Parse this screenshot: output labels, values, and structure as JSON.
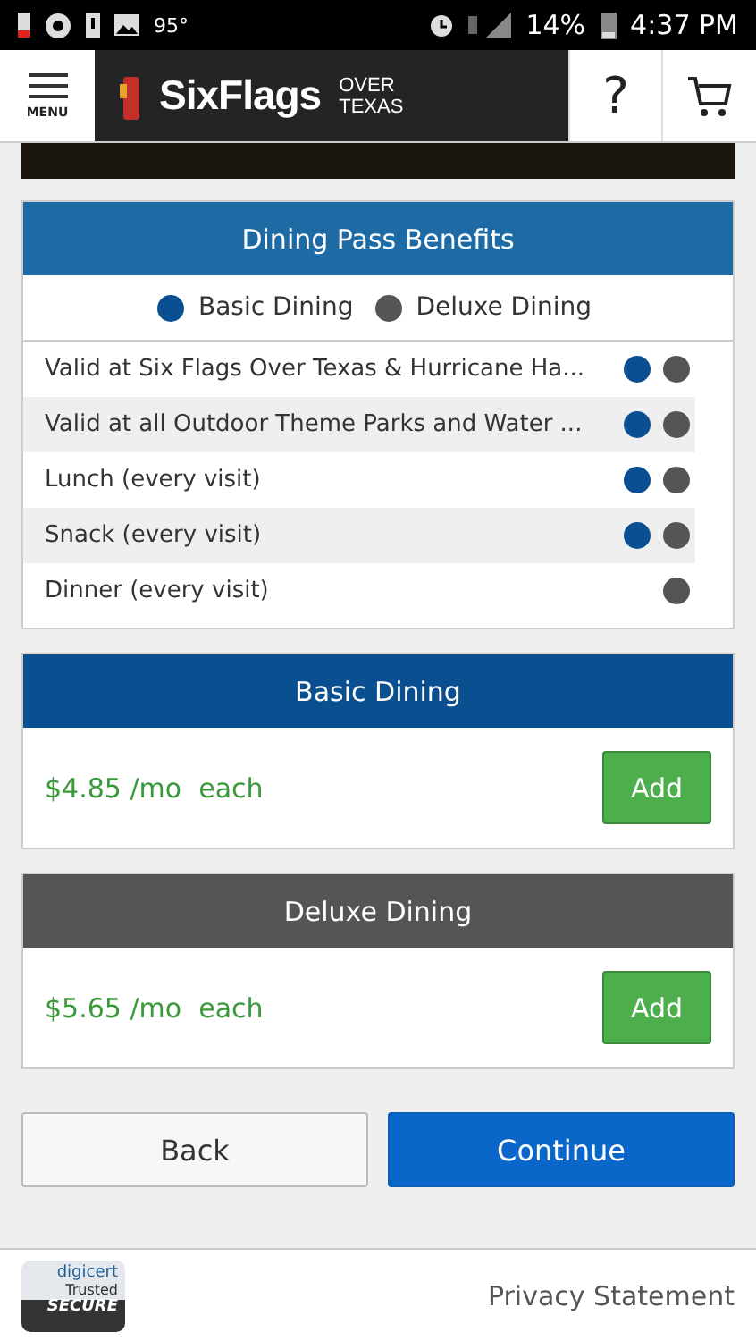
{
  "status_bar": {
    "temperature": "95°",
    "battery": "14%",
    "time": "4:37 PM"
  },
  "header": {
    "menu_label": "MENU",
    "logo": {
      "brand": "SixFlags",
      "park_line_1": "OVER",
      "park_line_2": "TEXAS"
    },
    "help_label": "?"
  },
  "benefits": {
    "title": "Dining Pass Benefits",
    "legend": [
      {
        "label": "Basic Dining",
        "color": "#0b4f93"
      },
      {
        "label": "Deluxe Dining",
        "color": "#555555"
      }
    ],
    "rows": [
      {
        "label": "Valid at Six Flags Over Texas & Hurricane Ha...",
        "basic": true,
        "deluxe": true
      },
      {
        "label": "Valid at all Outdoor Theme Parks and Water ...",
        "basic": true,
        "deluxe": true
      },
      {
        "label": "Lunch (every visit)",
        "basic": true,
        "deluxe": true
      },
      {
        "label": "Snack (every visit)",
        "basic": true,
        "deluxe": true
      },
      {
        "label": "Dinner (every visit)",
        "basic": false,
        "deluxe": true
      }
    ]
  },
  "plans": [
    {
      "name": "Basic Dining",
      "color": "#0a4f8f",
      "price": "$4.85 /mo  each",
      "button": "Add"
    },
    {
      "name": "Deluxe Dining",
      "color": "#555555",
      "price": "$5.65 /mo  each",
      "button": "Add"
    }
  ],
  "actions": {
    "back": "Back",
    "continue": "Continue"
  },
  "footer": {
    "badge": {
      "line_1": "digicert",
      "line_2": "Trusted",
      "line_3": "SECURE"
    },
    "privacy": "Privacy Statement"
  }
}
